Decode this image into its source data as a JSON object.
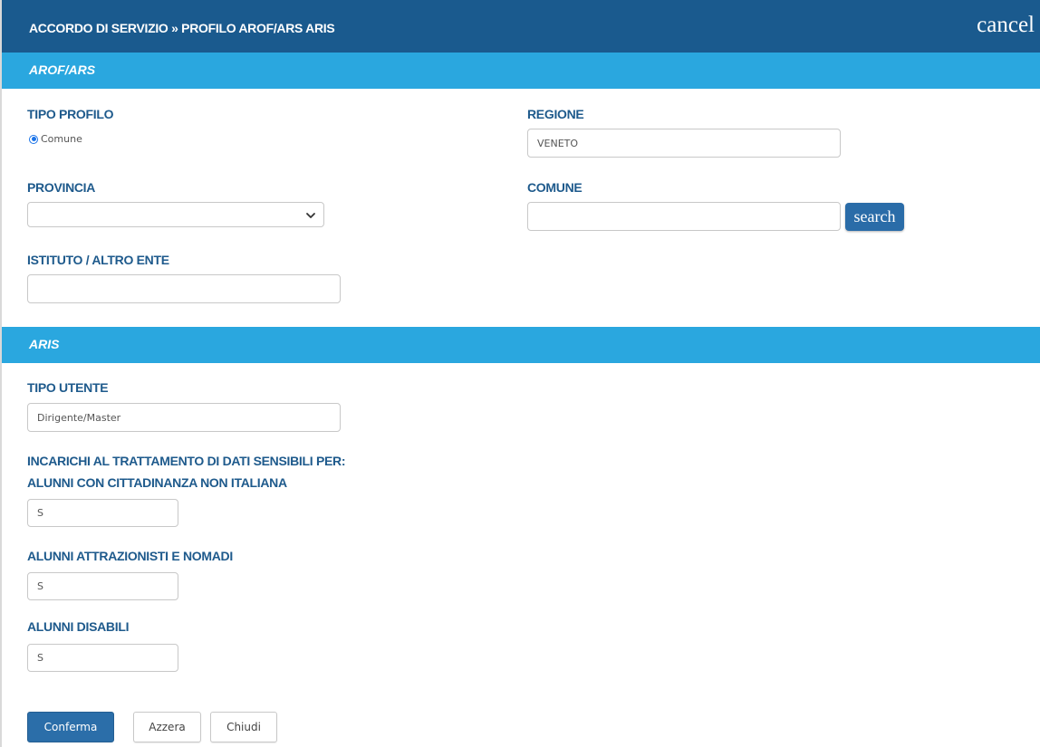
{
  "header": {
    "title": "ACCORDO DI SERVIZIO » PROFILO AROF/ARS ARIS",
    "cancel_label": "cancel"
  },
  "sections": {
    "arof_title": "AROF/ARS",
    "aris_title": "ARIS"
  },
  "arof": {
    "tipo_profilo_label": "TIPO PROFILO",
    "tipo_profilo_option": "Comune",
    "regione_label": "REGIONE",
    "regione_value": "VENETO",
    "provincia_label": "PROVINCIA",
    "provincia_value": "",
    "comune_label": "COMUNE",
    "comune_value": "",
    "search_label": "search",
    "istituto_label": "ISTITUTO / ALTRO ENTE",
    "istituto_value": ""
  },
  "aris": {
    "tipo_utente_label": "TIPO UTENTE",
    "tipo_utente_value": "Dirigente/Master",
    "incarichi_label_line1": "INCARICHI AL TRATTAMENTO DI DATI SENSIBILI PER:",
    "incarichi_label_line2": "ALUNNI CON CITTADINANZA NON ITALIANA",
    "cittadinanza_value": "S",
    "nomadi_label": "ALUNNI ATTRAZIONISTI E NOMADI",
    "nomadi_value": "S",
    "disabili_label": "ALUNNI DISABILI",
    "disabili_value": "S"
  },
  "buttons": {
    "confirm": "Conferma",
    "reset": "Azzera",
    "close": "Chiudi"
  },
  "colors": {
    "header_bg": "#1a5a8e",
    "section_bg": "#2aa7df",
    "label_text": "#1e5a8c",
    "primary_button": "#2b6ea9"
  },
  "icons": {
    "radio": "radio-selected-icon",
    "select": "chevron-down-icon"
  }
}
